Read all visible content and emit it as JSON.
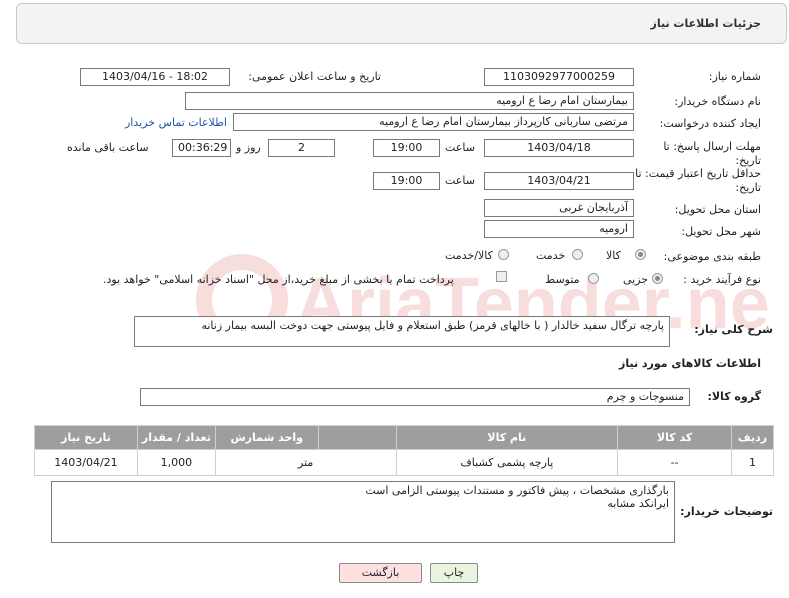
{
  "header": {
    "title": "جزئیات اطلاعات نیاز"
  },
  "need_number": {
    "label": "شماره نیاز:",
    "value": "1103092977000259"
  },
  "announce": {
    "label": "تاریخ و ساعت اعلان عمومی:",
    "value": "1403/04/16 - 18:02"
  },
  "buyer_org": {
    "label": "نام دستگاه خریدار:",
    "value": "بیمارستان امام رضا  ع  ارومیه"
  },
  "requester": {
    "label": "ایجاد کننده درخواست:",
    "value": "مرتضی ساربانی کارپرداز بیمارستان امام رضا  ع  ارومیه",
    "contact_link": "اطلاعات تماس خریدار"
  },
  "deadline": {
    "label": "مهلت ارسال پاسخ: تا تاریخ:",
    "date": "1403/04/18",
    "time_label": "ساعت",
    "time": "19:00",
    "days": "2",
    "days_label": "روز و",
    "remaining": "00:36:29",
    "remaining_label": "ساعت باقی مانده"
  },
  "price_validity": {
    "label": "حداقل تاریخ اعتبار قیمت: تا تاریخ:",
    "date": "1403/04/21",
    "time_label": "ساعت",
    "time": "19:00"
  },
  "province": {
    "label": "استان محل تحویل:",
    "value": "آذربایجان غربی"
  },
  "city": {
    "label": "شهر محل تحویل:",
    "value": "ارومیه"
  },
  "category": {
    "label": "طبقه بندی موضوعی:",
    "options": [
      "کالا",
      "خدمت",
      "کالا/خدمت"
    ],
    "selected": "کالا"
  },
  "process": {
    "label": "نوع فرآیند خرید :",
    "options": [
      "جزیی",
      "متوسط"
    ],
    "selected": "جزیی",
    "payment_note": "پرداخت تمام یا بخشی از مبلغ خرید،از محل \"اسناد خزانه اسلامی\" خواهد بود."
  },
  "description": {
    "label": "شرح کلی نیاز:",
    "value": "پارچه ترگال سفید خالدار ( با خالهای  قرمز) طبق استعلام و فایل پیوستی جهت دوخت البسه بیمار زنانه"
  },
  "goods_info": {
    "title": "اطلاعات کالاهای مورد نیاز",
    "group_label": "گروه کالا:",
    "group_value": "منسوجات و چرم"
  },
  "table": {
    "headers": [
      "ردیف",
      "کد کالا",
      "نام کالا",
      "واحد شمارش",
      "تعداد / مقدار",
      "تاریخ نیاز"
    ],
    "rows": [
      {
        "index": "1",
        "code": "--",
        "name": "پارچه پشمی کشباف",
        "unit": "متر",
        "qty": "1,000",
        "date": "1403/04/21"
      }
    ]
  },
  "buyer_notes": {
    "label": "توضیحات خریدار:",
    "line1": "بارگذاری مشخصات ، پیش فاکتور و مستندات پیوستی الزامی است",
    "line2": "ایرانکد مشابه"
  },
  "buttons": {
    "print": "چاپ",
    "back": "بازگشت"
  },
  "watermark": {
    "text": "AriaTender.neT"
  },
  "colors": {
    "back_button_bg": "#fde0e0",
    "print_button_bg": "#eaf5e0",
    "table_header_bg": "#9e9e9e",
    "link": "#1e55a8"
  }
}
